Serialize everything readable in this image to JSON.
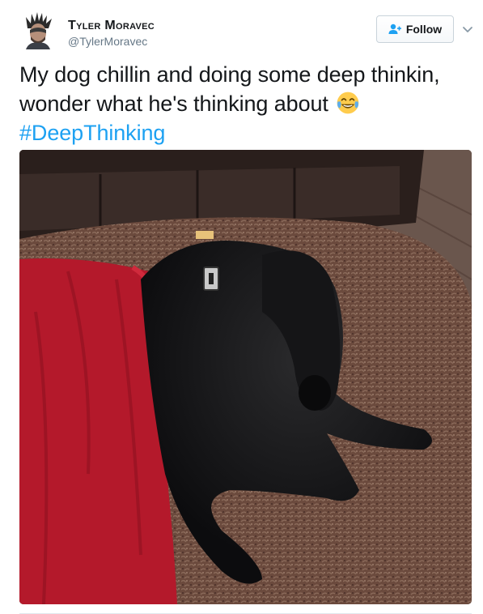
{
  "user": {
    "display_name": "Tyler Moravec",
    "handle": "@TylerMoravec",
    "avatar_icon": "profile-photo"
  },
  "follow_button": {
    "label": "Follow",
    "icon": "add-user-icon"
  },
  "menu": {
    "icon": "chevron-down-icon"
  },
  "tweet": {
    "line1": "My dog chillin and doing some deep thinkin,",
    "line2": "wonder what he's thinking about",
    "emoji": "face-with-tears-of-joy",
    "hashtag": "#DeepThinking"
  },
  "media": {
    "type": "photo",
    "subject": "black dog sitting on shag rug beside red blanket"
  },
  "colors": {
    "link": "#1da1f2",
    "handle": "#657786",
    "text": "#14171a",
    "border": "#e1e8ed"
  }
}
